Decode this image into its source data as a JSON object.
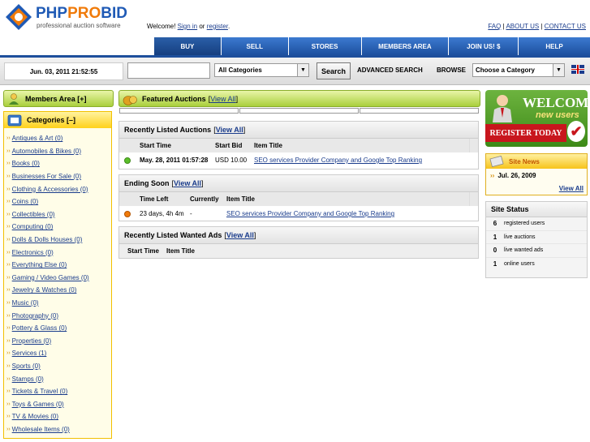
{
  "header": {
    "logo": {
      "brand_part1": "PHP",
      "brand_part2": "PRO",
      "brand_part3": "BID",
      "tagline": "professional auction software"
    },
    "welcome_text": "Welcome!",
    "sign_in": "Sign in",
    "or_text": "or",
    "register": "register",
    "top_links": [
      "FAQ",
      "ABOUT US",
      "CONTACT US"
    ],
    "nav_tabs": [
      "BUY",
      "SELL",
      "STORES",
      "MEMBERS AREA",
      "JOIN US! $",
      "HELP"
    ]
  },
  "search_bar": {
    "date": "Jun. 03, 2011 21:52:55",
    "search_value": "",
    "category_selected": "All Categories",
    "search_button": "Search",
    "advanced_search": "ADVANCED SEARCH",
    "browse_label": "BROWSE",
    "browse_selected": "Choose a Category"
  },
  "sidebar": {
    "members_area": "Members Area [+]",
    "categories_title": "Categories [–]",
    "categories": [
      "Antiques & Art (0)",
      "Automobiles & Bikes (0)",
      "Books (0)",
      "Businesses For Sale (0)",
      "Clothing & Accessories (0)",
      "Coins (0)",
      "Collectibles (0)",
      "Computing (0)",
      "Dolls & Dolls Houses (0)",
      "Electronics (0)",
      "Everything Else (0)",
      "Gaming / Video Games (0)",
      "Jewelry & Watches (0)",
      "Music (0)",
      "Photography (0)",
      "Pottery & Glass (0)",
      "Properties (0)",
      "Services (1)",
      "Sports (0)",
      "Stamps (0)",
      "Tickets & Travel (0)",
      "Toys & Games (0)",
      "TV & Movies (0)",
      "Wholesale Items (0)"
    ]
  },
  "main": {
    "featured_title": "Featured Auctions",
    "view_all": "View All",
    "recent_auctions": {
      "title": "Recently Listed Auctions",
      "columns": [
        "Start Time",
        "Start Bid",
        "Item Title"
      ],
      "rows": [
        {
          "start_time": "May. 28, 2011 01:57:28",
          "start_bid": "USD 10.00",
          "item_title": "SEO services Provider Company and Google Top Ranking"
        }
      ]
    },
    "ending_soon": {
      "title": "Ending Soon",
      "columns": [
        "Time Left",
        "Currently",
        "Item Title"
      ],
      "rows": [
        {
          "time_left": "23 days, 4h 4m",
          "currently": "-",
          "item_title": "SEO services Provider Company and Google Top Ranking"
        }
      ]
    },
    "wanted_ads": {
      "title": "Recently Listed Wanted Ads",
      "columns": [
        "Start Time",
        "Item Title"
      ]
    }
  },
  "right": {
    "welcome_banner": {
      "welcome": "WELCOME",
      "new_users": "new users",
      "register_today": "REGISTER TODAY"
    },
    "site_news": {
      "title": "Site News",
      "date": "Jul. 26, 2009",
      "view_all": "View All"
    },
    "site_status": {
      "title": "Site Status",
      "rows": [
        {
          "count": "6",
          "label": "registered users"
        },
        {
          "count": "1",
          "label": "live auctions"
        },
        {
          "count": "0",
          "label": "live wanted ads"
        },
        {
          "count": "1",
          "label": "online users"
        }
      ]
    }
  },
  "colors": {
    "nav_blue": "#1f57a8",
    "accent_orange": "#f07b0a",
    "green_header": "#a9cf3c",
    "category_yellow": "#ffd11a"
  }
}
